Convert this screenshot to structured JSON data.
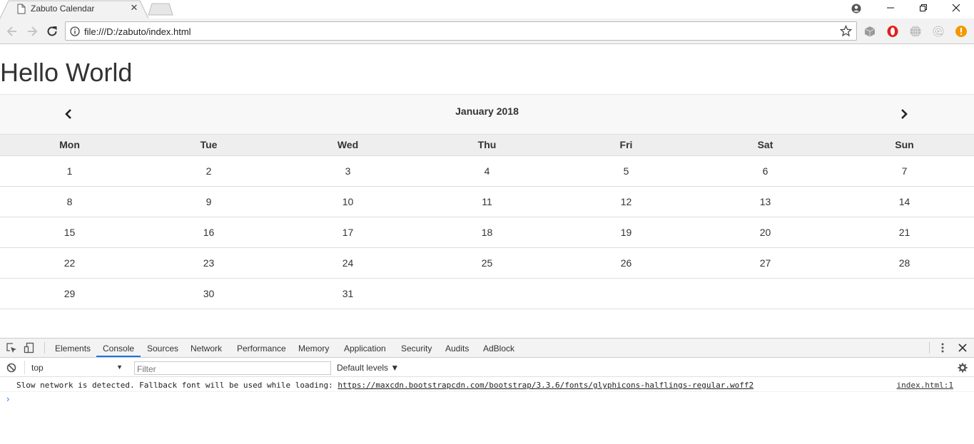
{
  "browser": {
    "tab_title": "Zabuto Calendar",
    "tab_close": "✕",
    "url": "file:///D:/zabuto/index.html"
  },
  "page": {
    "heading": "Hello World",
    "calendar": {
      "month_title": "January 2018",
      "weekdays": [
        "Mon",
        "Tue",
        "Wed",
        "Thu",
        "Fri",
        "Sat",
        "Sun"
      ],
      "weeks": [
        [
          "1",
          "2",
          "3",
          "4",
          "5",
          "6",
          "7"
        ],
        [
          "8",
          "9",
          "10",
          "11",
          "12",
          "13",
          "14"
        ],
        [
          "15",
          "16",
          "17",
          "18",
          "19",
          "20",
          "21"
        ],
        [
          "22",
          "23",
          "24",
          "25",
          "26",
          "27",
          "28"
        ],
        [
          "29",
          "30",
          "31",
          "",
          "",
          "",
          ""
        ]
      ]
    }
  },
  "devtools": {
    "tabs": [
      "Elements",
      "Console",
      "Sources",
      "Network",
      "Performance",
      "Memory",
      "Application",
      "Security",
      "Audits",
      "AdBlock"
    ],
    "active_tab": "Console",
    "context": "top",
    "filter_placeholder": "Filter",
    "levels": "Default levels ▼",
    "message": {
      "text": "Slow network is detected. Fallback font will be used while loading: ",
      "link": "https://maxcdn.bootstrapcdn.com/bootstrap/3.3.6/fonts/glyphicons-halflings-regular.woff2",
      "source": "index.html:1"
    },
    "prompt": "›"
  },
  "colors": {
    "devtools_accent": "#1a73e8",
    "opera_red": "#e0201c",
    "alert_orange": "#f29900"
  }
}
